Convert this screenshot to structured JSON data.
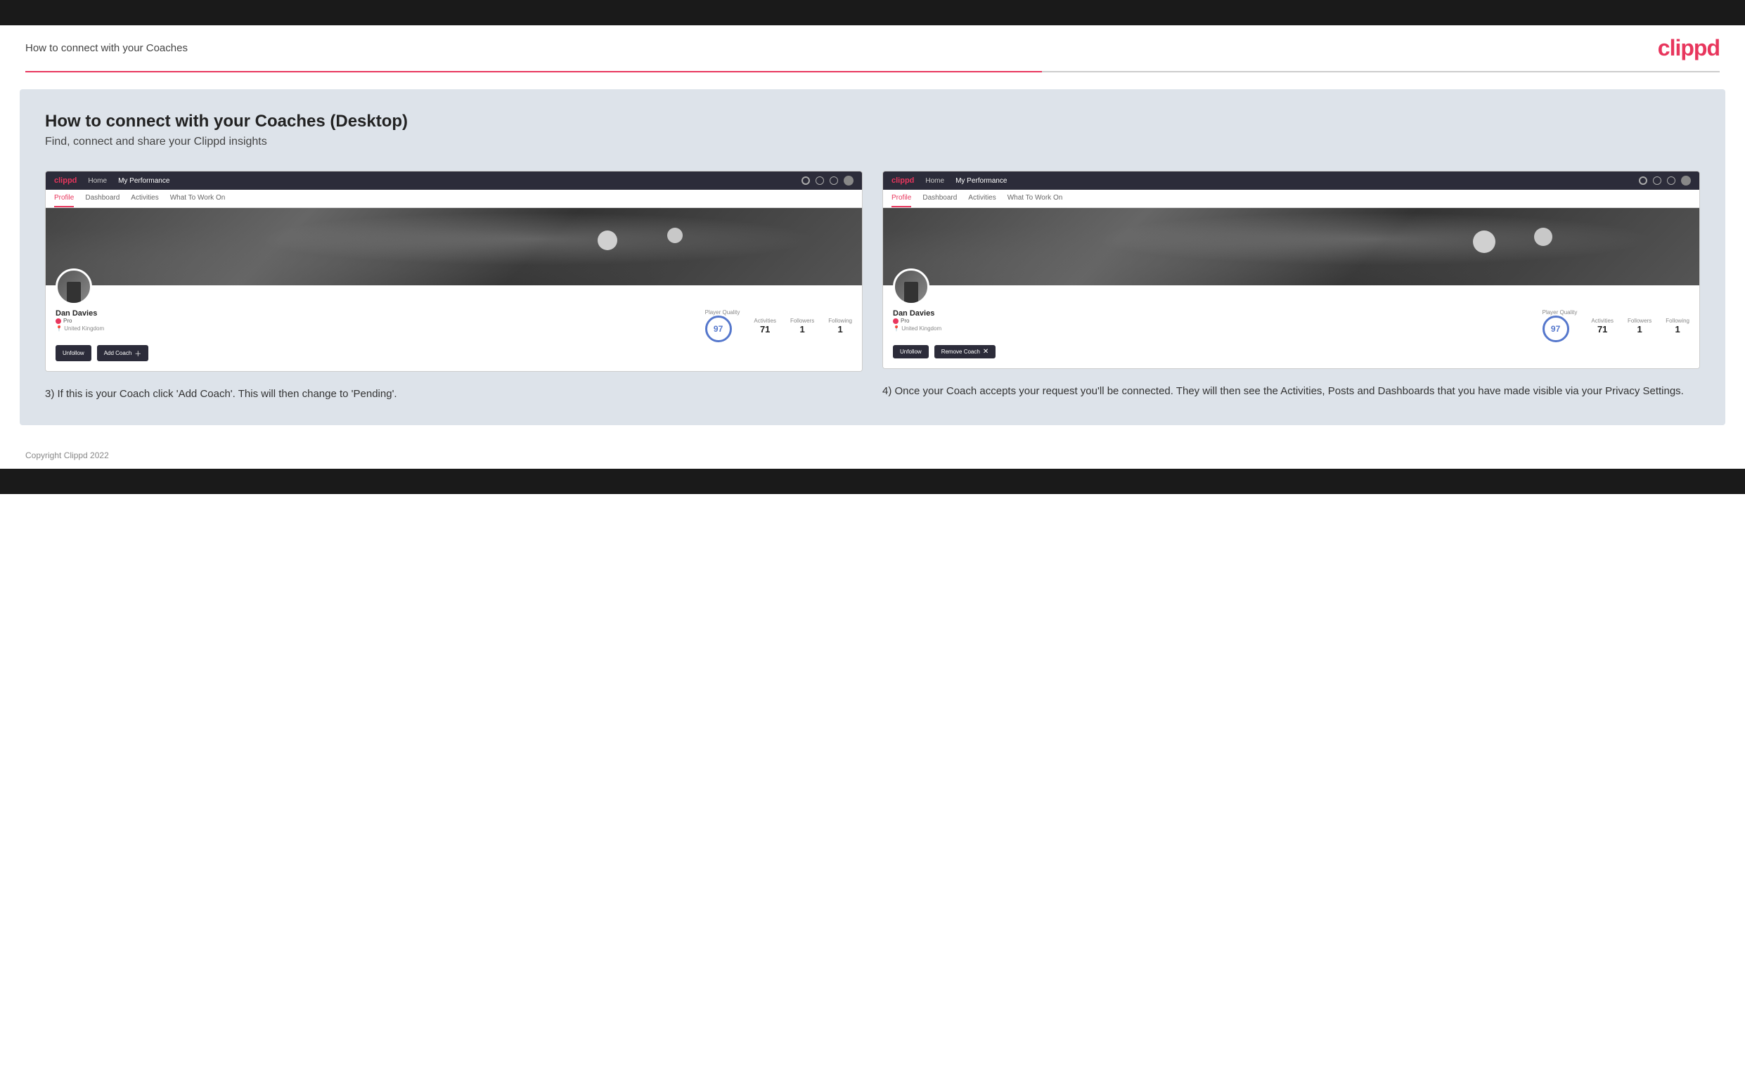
{
  "header": {
    "title": "How to connect with your Coaches",
    "logo": "clippd"
  },
  "main": {
    "title": "How to connect with your Coaches (Desktop)",
    "subtitle": "Find, connect and share your Clippd insights",
    "left_panel": {
      "step_number": "3",
      "description": "3) If this is your Coach click 'Add Coach'. This will then change to 'Pending'.",
      "mock": {
        "nav": {
          "logo": "clippd",
          "links": [
            "Home",
            "My Performance"
          ],
          "icons": [
            "search",
            "user",
            "settings",
            "avatar"
          ]
        },
        "tabs": [
          "Profile",
          "Dashboard",
          "Activities",
          "What To Work On"
        ],
        "active_tab": "Profile",
        "player_name": "Dan Davies",
        "player_badge": "Pro",
        "player_location": "United Kingdom",
        "stats": {
          "player_quality_label": "Player Quality",
          "player_quality_value": "97",
          "activities_label": "Activities",
          "activities_value": "71",
          "followers_label": "Followers",
          "followers_value": "1",
          "following_label": "Following",
          "following_value": "1"
        },
        "buttons": [
          "Unfollow",
          "Add Coach"
        ]
      }
    },
    "right_panel": {
      "step_number": "4",
      "description": "4) Once your Coach accepts your request you'll be connected. They will then see the Activities, Posts and Dashboards that you have made visible via your Privacy Settings.",
      "mock": {
        "nav": {
          "logo": "clippd",
          "links": [
            "Home",
            "My Performance"
          ],
          "icons": [
            "search",
            "user",
            "settings",
            "avatar"
          ]
        },
        "tabs": [
          "Profile",
          "Dashboard",
          "Activities",
          "What To Work On"
        ],
        "active_tab": "Profile",
        "player_name": "Dan Davies",
        "player_badge": "Pro",
        "player_location": "United Kingdom",
        "stats": {
          "player_quality_label": "Player Quality",
          "player_quality_value": "97",
          "activities_label": "Activities",
          "activities_value": "71",
          "followers_label": "Followers",
          "followers_value": "1",
          "following_label": "Following",
          "following_value": "1"
        },
        "buttons": [
          "Unfollow",
          "Remove Coach"
        ]
      }
    }
  },
  "footer": {
    "copyright": "Copyright Clippd 2022"
  }
}
